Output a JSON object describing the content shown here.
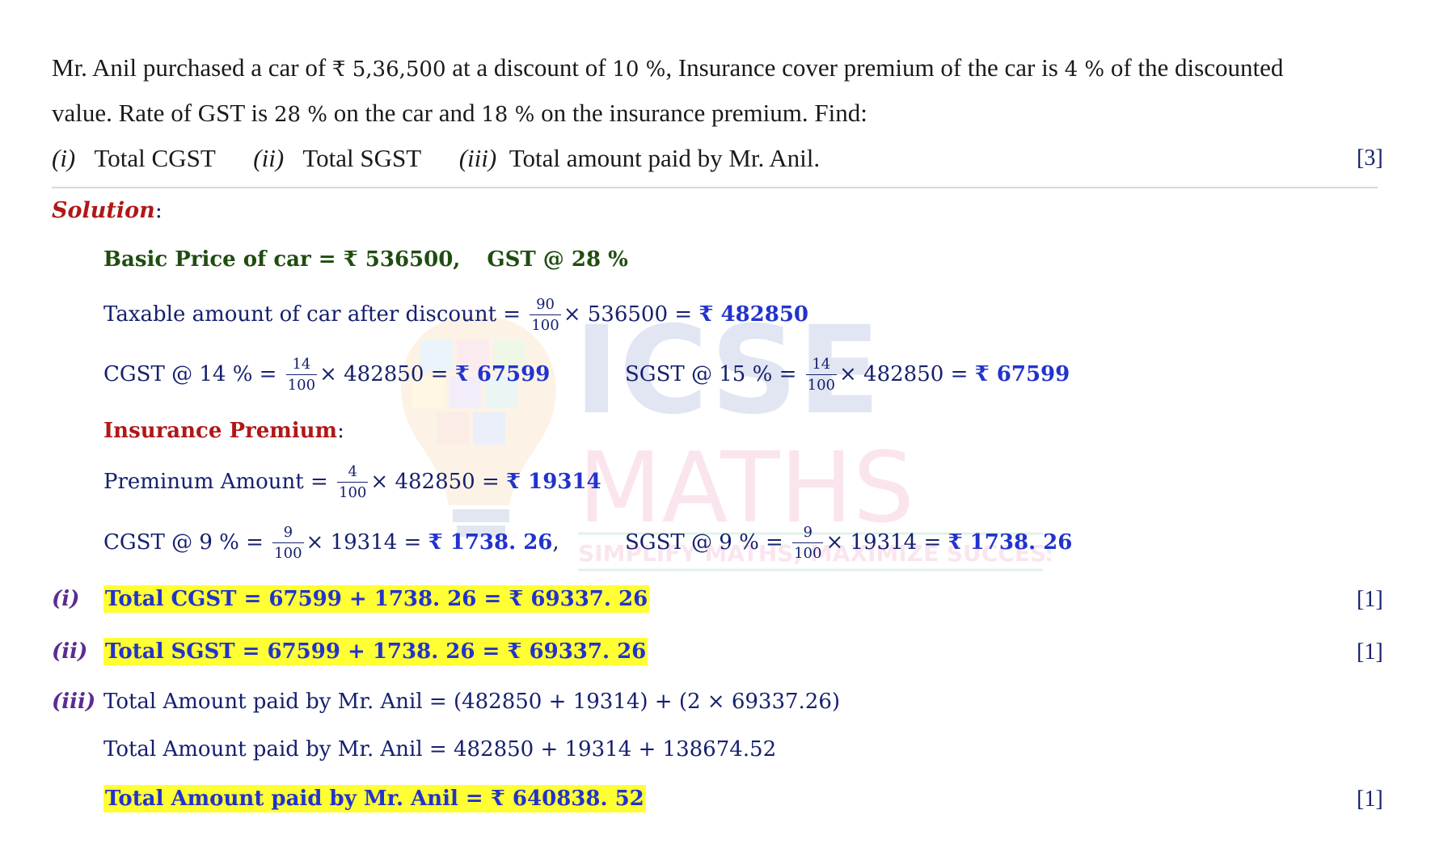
{
  "question": {
    "line1_a": "Mr. Anil purchased a car of ",
    "line1_amt": "₹ 5,36,500",
    "line1_b": " at a discount of ",
    "line1_disc": "10 %",
    "line1_c": ", Insurance cover premium of the car is ",
    "line1_pct": "4 %",
    "line1_d": " of the discounted",
    "line2_a": "value. Rate of GST is ",
    "line2_car": "28 %",
    "line2_b": " on the car and ",
    "line2_ins": "18 %",
    "line2_c": " on the insurance premium. Find:",
    "parts": [
      {
        "num": "(i)",
        "text": "Total CGST"
      },
      {
        "num": "(ii)",
        "text": "Total SGST"
      },
      {
        "num": "(iii)",
        "text": "Total amount paid by Mr. Anil."
      }
    ],
    "marks": "[3]"
  },
  "solution": {
    "heading": "Solution",
    "colon": ":",
    "basic_price": "Basic Price of car = ₹ 536500,",
    "gst_rate": "GST @ 28 %",
    "taxable_label": "Taxable amount of car after discount = ",
    "taxable_num": "90",
    "taxable_den": "100",
    "taxable_mid": "× 536500 = ",
    "taxable_val": "₹ 482850",
    "cgst_car_label": "CGST @ 14 % = ",
    "cgst_car_num": "14",
    "cgst_car_den": "100",
    "cgst_car_mid": "× 482850 = ",
    "cgst_car_val": "₹ 67599",
    "sgst_car_label": "SGST @ 15 % = ",
    "sgst_car_num": "14",
    "sgst_car_den": "100",
    "sgst_car_mid": "× 482850 = ",
    "sgst_car_val": "₹ 67599",
    "ins_heading": "Insurance Premium",
    "ins_colon": ":",
    "premium_label": "Preminum Amount = ",
    "premium_num": "4",
    "premium_den": "100",
    "premium_mid": "× 482850 = ",
    "premium_val": "₹ 19314",
    "cgst_ins_label": "CGST @ 9 % = ",
    "cgst_ins_num": "9",
    "cgst_ins_den": "100",
    "cgst_ins_mid": "× 19314 = ",
    "cgst_ins_val": "₹ 1738. 26",
    "cgst_ins_comma": ",",
    "sgst_ins_label": "SGST @ 9 % = ",
    "sgst_ins_num": "9",
    "sgst_ins_den": "100",
    "sgst_ins_mid": "× 19314 = ",
    "sgst_ins_val": "₹ 1738. 26",
    "answers": [
      {
        "num": "(i)",
        "text": "Total CGST = 67599 + 1738. 26 = ₹ 69337. 26",
        "marks": "[1]"
      },
      {
        "num": "(ii)",
        "text": "Total SGST = 67599 + 1738. 26 = ₹ 69337. 26",
        "marks": "[1]"
      }
    ],
    "part3_num": "(iii)",
    "part3_line1": "Total Amount paid by Mr. Anil = (482850 + 19314) + (2 × 69337.26)",
    "part3_line2": "Total Amount paid by Mr. Anil = 482850 + 19314 + 138674.52",
    "part3_final": "Total Amount paid by Mr. Anil = ₹ 640838. 52",
    "part3_marks": "[1]"
  },
  "watermark": {
    "logo": "ICSE",
    "subject": "MATHS",
    "tagline": "SIMPLIFY MATHS, MAXIMIZE SUCCESS",
    "colors": {
      "blue": "#9aa7d6",
      "orange": "#f0a07a",
      "pink": "#f0a6c4",
      "green": "#9bd3b0"
    }
  }
}
